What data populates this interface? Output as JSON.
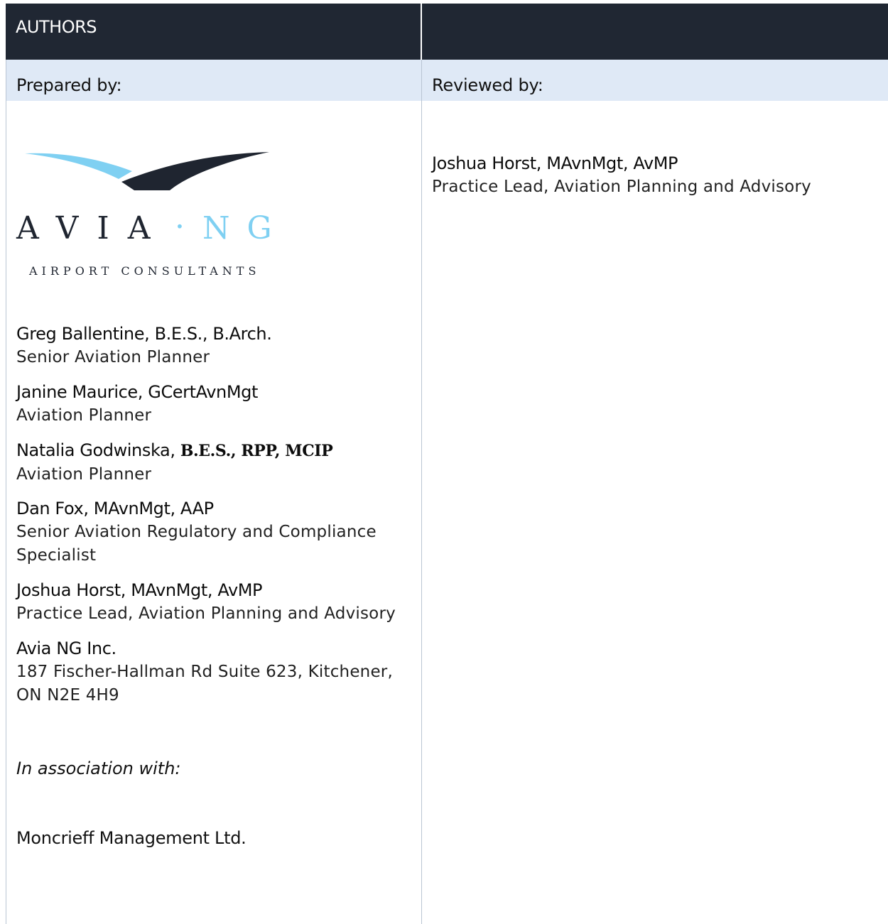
{
  "table": {
    "title": "AUTHORS",
    "headers": {
      "prepared": "Prepared by:",
      "reviewed": "Reviewed by:"
    }
  },
  "logo": {
    "wordmark_left": "AVIA",
    "wordmark_dot": "·",
    "wordmark_right": "NG",
    "tagline": "AIRPORT CONSULTANTS",
    "colors": {
      "dark": "#1f2530",
      "light_blue": "#7fd0f2"
    }
  },
  "prepared_by": [
    {
      "name": "Greg Ballentine, B.E.S., B.Arch.",
      "role": "Senior Aviation Planner"
    },
    {
      "name": "Janine Maurice, GCertAvnMgt",
      "role": "Aviation Planner"
    },
    {
      "name_main": "Natalia Godwinska, ",
      "name_creds": "B.E.S., RPP, MCIP",
      "role": "Aviation Planner"
    },
    {
      "name": "Dan Fox, MAvnMgt, AAP",
      "role_line1": "Senior Aviation Regulatory and Compliance",
      "role_line2": "Specialist"
    },
    {
      "name": "Joshua Horst, MAvnMgt, AvMP",
      "role": "Practice Lead, Aviation Planning and Advisory"
    },
    {
      "name": "Avia NG Inc.",
      "address_line1": "187 Fischer-Hallman Rd Suite 623, Kitchener,",
      "address_line2": "ON N2E 4H9"
    }
  ],
  "association": {
    "label": "In association with:",
    "company": "Moncrieff Management Ltd."
  },
  "reviewed_by": {
    "name": "Joshua Horst, MAvnMgt, AvMP",
    "role": "Practice Lead, Aviation Planning and Advisory"
  },
  "colors": {
    "title_bar": "#202733",
    "header_bar": "#dfe9f6",
    "border": "#b9c5d3"
  }
}
